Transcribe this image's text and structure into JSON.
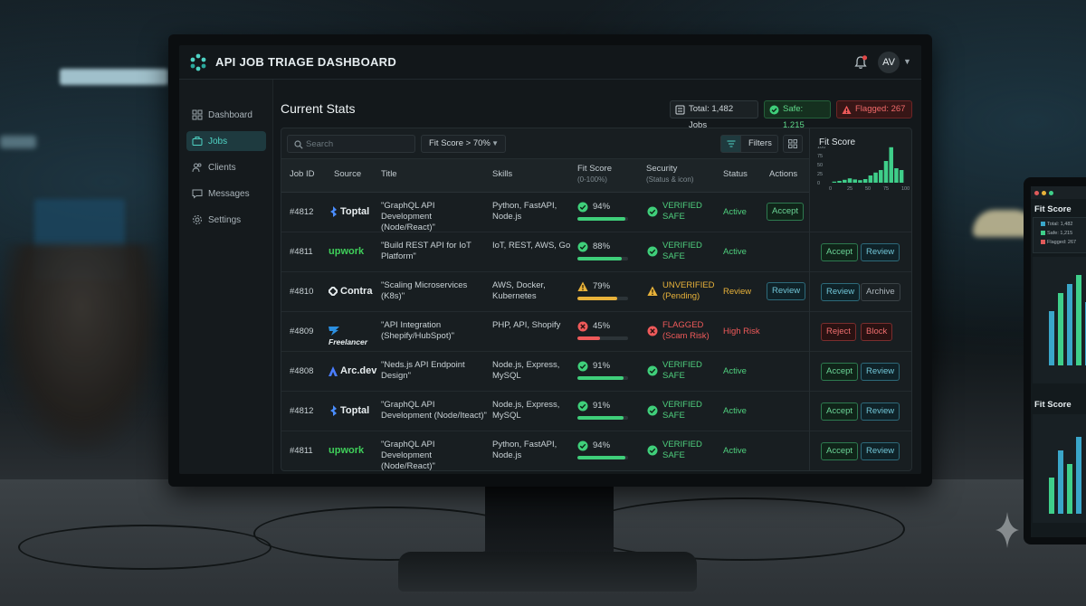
{
  "app": {
    "title": "API JOB TRIAGE DASHBOARD",
    "avatar_initials": "AV"
  },
  "sidebar": {
    "items": [
      {
        "label": "Dashboard",
        "icon": "grid-icon",
        "active": false
      },
      {
        "label": "Jobs",
        "icon": "briefcase-icon",
        "active": true
      },
      {
        "label": "Clients",
        "icon": "users-icon",
        "active": false
      },
      {
        "label": "Messages",
        "icon": "message-icon",
        "active": false
      },
      {
        "label": "Settings",
        "icon": "gear-icon",
        "active": false
      }
    ]
  },
  "main": {
    "title": "Current Stats",
    "stats": {
      "total": "Total: 1,482 Jobs",
      "safe": "Safe: 1,215",
      "flagged": "Flagged: 267"
    }
  },
  "toolbar": {
    "search_placeholder": "Search",
    "fit_filter": "Fit Score > 70%",
    "filters_label": "Filters"
  },
  "table": {
    "headers": {
      "job_id": "Job ID",
      "source": "Source",
      "title": "Title",
      "skills": "Skills",
      "fit": "Fit Score",
      "fit_sub": "(0-100%)",
      "security": "Security",
      "security_sub": "(Status & icon)",
      "status": "Status",
      "actions": "Actions"
    },
    "rows": [
      {
        "id": "#4812",
        "source": "Toptal",
        "title": "\"GraphQL API Development (Node/React)\"",
        "skills": "Python, FastAPI, Node.js",
        "fit": "94%",
        "fit_value": 94,
        "fit_level": "green",
        "security": "VERIFIED SAFE",
        "security_level": "green",
        "status": "Active",
        "status_level": "green",
        "action": "Accept",
        "side_actions": []
      },
      {
        "id": "#4811",
        "source": "upwork",
        "title": "\"Build REST API for IoT Platform\"",
        "skills": "IoT, REST, AWS, Go",
        "fit": "88%",
        "fit_value": 88,
        "fit_level": "green",
        "security": "VERIFIED SAFE",
        "security_level": "green",
        "status": "Active",
        "status_level": "green",
        "action": "",
        "side_actions": [
          "Accept",
          "Review"
        ]
      },
      {
        "id": "#4810",
        "source": "Contra",
        "title": "\"Scaling Microservices (K8s)\"",
        "skills": "AWS, Docker, Kubernetes",
        "fit": "79%",
        "fit_value": 79,
        "fit_level": "amber",
        "security": "UNVERIFIED (Pending)",
        "security_level": "amber",
        "status": "Review",
        "status_level": "amber",
        "action": "Review",
        "side_actions": [
          "Review",
          "Archive"
        ]
      },
      {
        "id": "#4809",
        "source": "Freelancer",
        "title": "\"API Integration (Shepify/HubSpot)\"",
        "skills": "PHP, API, Shopify",
        "fit": "45%",
        "fit_value": 45,
        "fit_level": "red",
        "security": "FLAGGED (Scam Risk)",
        "security_level": "red",
        "status": "High Risk",
        "status_level": "red",
        "action": "",
        "side_actions": [
          "Reject",
          "Block"
        ]
      },
      {
        "id": "#4808",
        "source": "Arc.dev",
        "title": "\"Neds.js API Endpoint Design\"",
        "skills": "Node.js, Express, MySQL",
        "fit": "91%",
        "fit_value": 91,
        "fit_level": "green",
        "security": "VERIFIED SAFE",
        "security_level": "green",
        "status": "Active",
        "status_level": "green",
        "action": "",
        "side_actions": [
          "Accept",
          "Review"
        ]
      },
      {
        "id": "#4812",
        "source": "Toptal",
        "title": "\"GraphQL API Development (Node/Iteact)\"",
        "skills": "Node.js, Express, MySQL",
        "fit": "91%",
        "fit_value": 91,
        "fit_level": "green",
        "security": "VERIFIED SAFE",
        "security_level": "green",
        "status": "Active",
        "status_level": "green",
        "action": "",
        "side_actions": [
          "Accept",
          "Review"
        ]
      },
      {
        "id": "#4811",
        "source": "upwork",
        "title": "\"GraphQL API Development (Node/React)\"",
        "skills": "Python, FastAPI, Node.js",
        "fit": "94%",
        "fit_value": 94,
        "fit_level": "green",
        "security": "VERIFIED SAFE",
        "security_level": "green",
        "status": "Active",
        "status_level": "green",
        "action": "",
        "side_actions": [
          "Accept",
          "Review"
        ]
      }
    ]
  },
  "fit_panel": {
    "title": "Fit Score",
    "y_ticks": [
      "100",
      "75",
      "50",
      "25",
      "0"
    ],
    "x_ticks": [
      "0",
      "25",
      "50",
      "75",
      "100"
    ]
  },
  "tablet": {
    "chart1_title": "Fit Score",
    "legend": [
      {
        "label": "Total: 1,482",
        "color": "#3aa6c9"
      },
      {
        "label": "Safe: 1,215",
        "color": "#3fcf8a"
      },
      {
        "label": "Flagged: 267",
        "color": "#e05a5a"
      }
    ],
    "chart2_title": "Fit Score"
  },
  "chart_data": {
    "type": "bar",
    "title": "Fit Score",
    "values": [
      3,
      5,
      8,
      12,
      9,
      7,
      10,
      20,
      28,
      35,
      60,
      98,
      40,
      35
    ],
    "ylim": [
      0,
      100
    ],
    "xlim": [
      0,
      100
    ],
    "color": "#3fcf8a"
  },
  "colors": {
    "accent": "#4fd3c4",
    "green": "#4fd07e",
    "amber": "#e8b23a",
    "red": "#ef5a5a"
  }
}
